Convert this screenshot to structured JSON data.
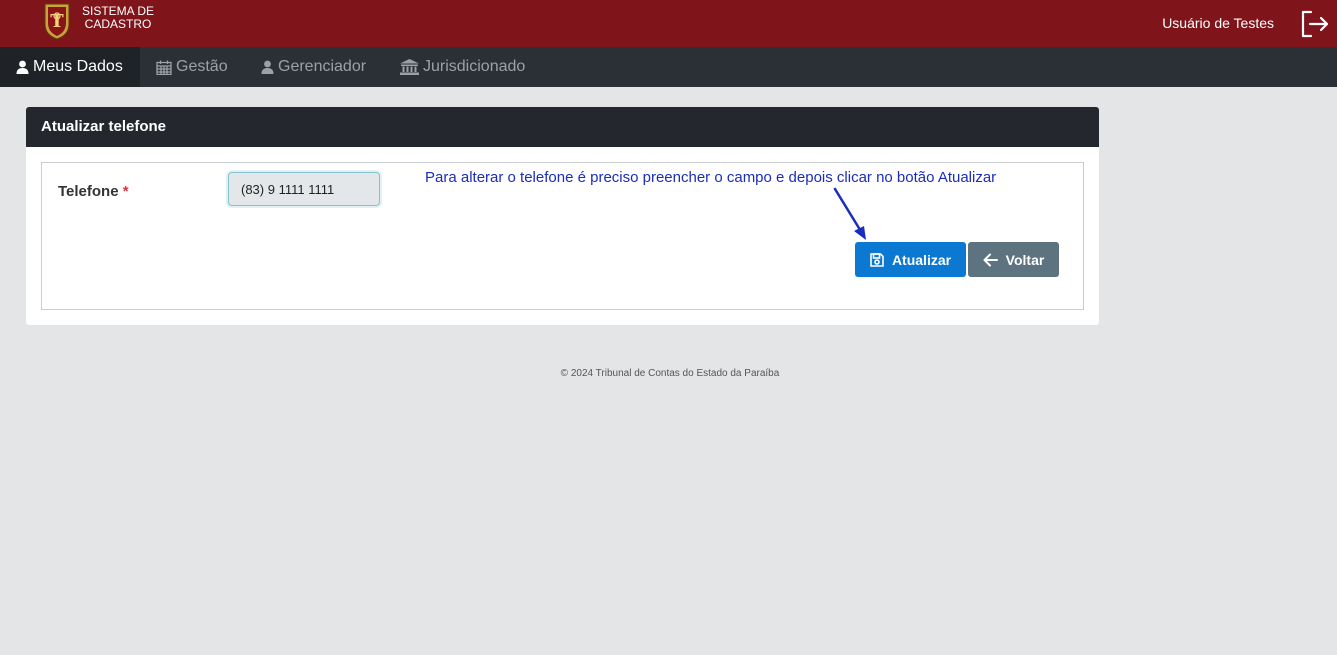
{
  "header": {
    "brand_line1": "SISTEMA DE",
    "brand_line2": "CADASTRO",
    "user_name": "Usuário de Testes",
    "brand_color": "#7f141b"
  },
  "nav": {
    "items": [
      {
        "label": "Meus Dados",
        "icon": "user-icon",
        "active": true
      },
      {
        "label": "Gestão",
        "icon": "calendar-icon"
      },
      {
        "label": "Gerenciador",
        "icon": "user-icon"
      },
      {
        "label": "Jurisdicionado",
        "icon": "bank-icon"
      }
    ]
  },
  "card": {
    "title": "Atualizar telefone",
    "field_label": "Telefone",
    "required_mark": "*",
    "phone_value": "(83) 9 1111 1111",
    "note": "Para alterar o telefone é preciso preencher o campo e depois clicar no botão Atualizar",
    "update_label": "Atualizar",
    "back_label": "Voltar",
    "update_color": "#0b78d1",
    "back_color": "#5d7380"
  },
  "footer": {
    "text": "© 2024 Tribunal de Contas do Estado da Paraíba"
  }
}
